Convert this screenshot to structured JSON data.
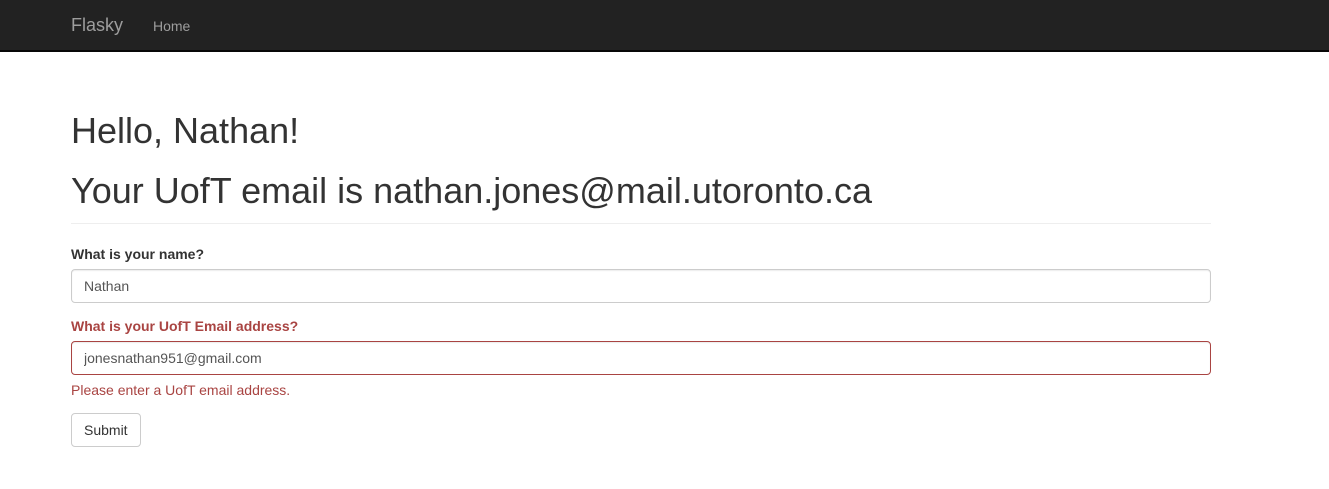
{
  "navbar": {
    "brand": "Flasky",
    "links": [
      {
        "label": "Home"
      }
    ]
  },
  "main": {
    "greeting": "Hello, Nathan!",
    "email_line": "Your UofT email is nathan.jones@mail.utoronto.ca",
    "form": {
      "name_field": {
        "label": "What is your name?",
        "value": "Nathan"
      },
      "email_field": {
        "label": "What is your UofT Email address?",
        "value": "jonesnathan951@gmail.com",
        "error": "Please enter a UofT email address."
      },
      "submit_label": "Submit"
    }
  },
  "colors": {
    "navbar_bg": "#222222",
    "error": "#a94442"
  }
}
